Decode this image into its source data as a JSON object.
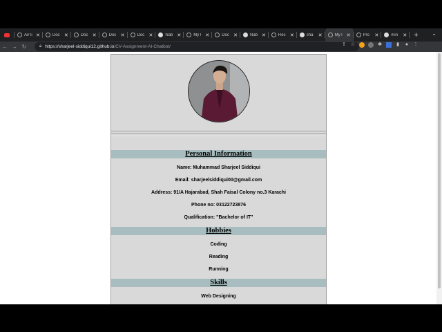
{
  "browser": {
    "tabs": [
      {
        "label": "",
        "icon": "youtube-icon",
        "active": false
      },
      {
        "label": "Air li",
        "icon": "globe-icon",
        "active": false
      },
      {
        "label": "Doc",
        "icon": "globe-icon",
        "active": false
      },
      {
        "label": "Doc",
        "icon": "globe-icon",
        "active": false
      },
      {
        "label": "Doc",
        "icon": "globe-icon",
        "active": false
      },
      {
        "label": "Doc",
        "icon": "globe-icon",
        "active": false
      },
      {
        "label": "Nab",
        "icon": "github-icon",
        "active": false
      },
      {
        "label": "My l",
        "icon": "globe-icon",
        "active": false
      },
      {
        "label": "Doc",
        "icon": "globe-icon",
        "active": false
      },
      {
        "label": "Nab",
        "icon": "github-icon",
        "active": false
      },
      {
        "label": "Res",
        "icon": "globe-icon",
        "active": false
      },
      {
        "label": "sha",
        "icon": "github-icon",
        "active": false
      },
      {
        "label": "My l",
        "icon": "globe-icon",
        "active": true
      },
      {
        "label": "Pro",
        "icon": "globe-icon",
        "active": false
      },
      {
        "label": "min",
        "icon": "github-icon",
        "active": false
      }
    ],
    "new_tab": "+",
    "tab_menu": "⌄",
    "url_host": "https://sharjeel-siddiqui12.github.io",
    "url_path": "/CV-Assignment-AI-Chatbot/"
  },
  "cv": {
    "personal_heading": "Personal Information",
    "name": "Name: Muhammad Sharjeel Siddiqui",
    "email": "Email: sharjeelsiddiqui00@gmail.com",
    "address": "Address: 91/A Hajarabad, Shah Faisal Colony no.3 Karachi",
    "phone": "Phone no: 03122723876",
    "qualification": "Qualification: \"Bachelor of IT\"",
    "hobbies_heading": "Hobbies",
    "hobbies": [
      "Coding",
      "Reading",
      "Running"
    ],
    "skills_heading": "Skills",
    "skills": [
      "Web Designing"
    ]
  },
  "colors": {
    "section_bg": "#a7bdbf",
    "card_bg": "#d9d9d9"
  }
}
